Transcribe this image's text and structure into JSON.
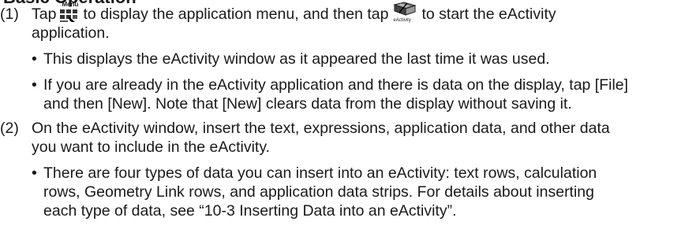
{
  "section_heading": "Basic Operation",
  "steps": [
    {
      "number": "(1)",
      "line1_a": "Tap",
      "line1_b": "to display the application menu, and then tap",
      "line1_c": "to start the eActivity",
      "line2": "application.",
      "bullets": [
        {
          "lines": [
            "This displays the eActivity window as it appeared the last time it was used."
          ]
        },
        {
          "lines": [
            "If you are already in the eActivity application and there is data on the display, tap [File]",
            "and then [New]. Note that [New] clears data from the display without saving it."
          ]
        }
      ]
    },
    {
      "number": "(2)",
      "line1": "On the eActivity window, insert the text, expressions, application data, and other data",
      "line2": "you want to include in the eActivity.",
      "bullets": [
        {
          "lines": [
            "There are four types of data you can insert into an eActivity: text rows, calculation",
            "rows, Geometry Link rows, and application data strips. For details about inserting",
            "each type of data, see “10-3 Inserting Data into an eActivity”."
          ]
        }
      ]
    }
  ],
  "icons": {
    "menu_icon": {
      "name": "menu-icon",
      "caption": "Menu"
    },
    "eactivity_icon": {
      "name": "eactivity-icon",
      "caption": "eActivity"
    }
  },
  "bullet_glyph": "•"
}
